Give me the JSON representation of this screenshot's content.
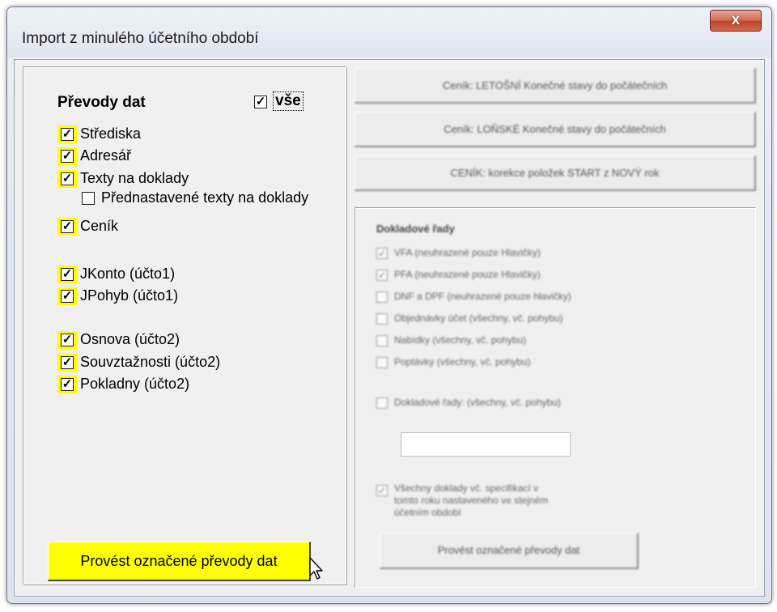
{
  "window": {
    "title": "Import z minulého účetního období",
    "close_label": "x"
  },
  "left": {
    "heading": "Převody dat",
    "all": {
      "label": "vše",
      "checked": true
    },
    "items": [
      {
        "label": "Střediska",
        "checked": true,
        "highlighted": true
      },
      {
        "label": "Adresář",
        "checked": true,
        "highlighted": true
      },
      {
        "label": "Texty na doklady",
        "checked": true,
        "highlighted": true
      },
      {
        "label": "Přednastavené texty na doklady",
        "checked": false,
        "highlighted": false
      },
      {
        "label": "Ceník",
        "checked": true,
        "highlighted": true
      },
      {
        "label": "JKonto (účto1)",
        "checked": true,
        "highlighted": true
      },
      {
        "label": "JPohyb  (účto1)",
        "checked": true,
        "highlighted": true
      },
      {
        "label": "Osnova (účto2)",
        "checked": true,
        "highlighted": true
      },
      {
        "label": "Souvztažnosti (účto2)",
        "checked": true,
        "highlighted": true
      },
      {
        "label": "Pokladny (účto2)",
        "checked": true,
        "highlighted": true
      }
    ],
    "action_label": "Provést označené převody dat"
  },
  "right": {
    "buttons": [
      "Ceník: LETOŠNÍ Konečné stavy do počátečních",
      "Ceník: LOŇSKÉ Konečné stavy do počátečních",
      "CENÍK: korekce položek START z NOVÝ rok"
    ],
    "group_title": "Dokladové řady",
    "items": [
      {
        "label": "VFA (neuhrazené pouze Hlavičky)",
        "checked": true
      },
      {
        "label": "PFA (neuhrazené pouze Hlavičky)",
        "checked": true
      },
      {
        "label": "DNF a DPF (neuhrazené pouze hlavičky)",
        "checked": false
      },
      {
        "label": "Objednávky účet (všechny, vč. pohybu)",
        "checked": false
      },
      {
        "label": "Nabídky (všechny, vč. pohybu)",
        "checked": false
      },
      {
        "label": "Poptávky (všechny, vč. pohybu)",
        "checked": false
      },
      {
        "label": "Dokladové řady: (všechny, vč. pohybu)",
        "checked": false
      }
    ],
    "input_value": "",
    "note": "Všechny doklady vč. specifikací v tomto roku nastaveného ve stejném účetním období",
    "note_checked": true,
    "action_label": "Provést označené převody dat"
  }
}
